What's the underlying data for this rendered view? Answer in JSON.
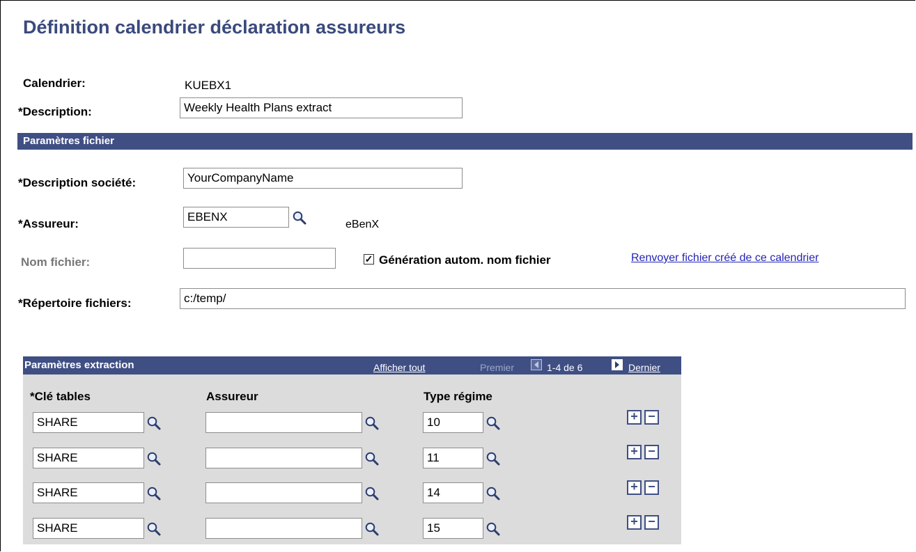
{
  "page": {
    "title": "Définition calendrier déclaration assureurs"
  },
  "form": {
    "calendar_label": "Calendrier:",
    "calendar_value": "KUEBX1",
    "description_label": "*Description:",
    "description_value": "Weekly Health Plans extract"
  },
  "file_params": {
    "section_title": "Paramètres fichier",
    "company_label": "*Description société:",
    "company_value": "YourCompanyName",
    "insurer_label": "*Assureur:",
    "insurer_value": "EBENX",
    "insurer_name": "eBenX",
    "filename_label": "Nom fichier:",
    "filename_value": "",
    "auto_filename_label": "Génération autom. nom fichier",
    "auto_filename_checked": true,
    "resend_link": "Renvoyer fichier créé de ce calendrier",
    "directory_label": "*Répertoire fichiers:",
    "directory_value": "c:/temp/"
  },
  "extraction": {
    "section_title": "Paramètres extraction",
    "view_all": "Afficher tout",
    "first": "Premier",
    "range": "1-4 de 6",
    "last": "Dernier",
    "columns": [
      "*Clé tables",
      "Assureur",
      "Type régime"
    ],
    "rows": [
      {
        "setid": "SHARE",
        "insurer": "",
        "plan_type": "10"
      },
      {
        "setid": "SHARE",
        "insurer": "",
        "plan_type": "11"
      },
      {
        "setid": "SHARE",
        "insurer": "",
        "plan_type": "14"
      },
      {
        "setid": "SHARE",
        "insurer": "",
        "plan_type": "15"
      }
    ],
    "add_symbol": "+",
    "delete_symbol": "−"
  },
  "colors": {
    "header_bar": "#3f4f84",
    "title": "#3a4a7c",
    "link": "#2323b8",
    "grid_background": "#dcdcdc"
  },
  "icons": {
    "lookup": "magnifier-icon",
    "prev": "arrow-left-icon",
    "next": "arrow-right-icon",
    "add_row": "plus-icon",
    "delete_row": "minus-icon"
  }
}
